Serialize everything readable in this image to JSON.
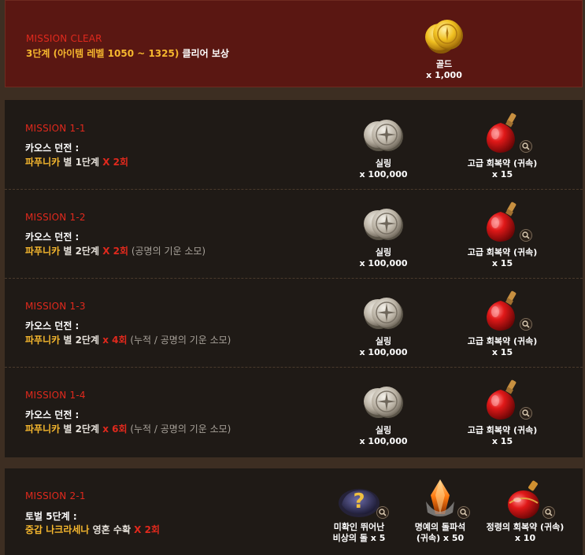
{
  "clear": {
    "title": "MISSION CLEAR",
    "desc_yellow": "3단계 (아이템 레벨 1050 ~ 1325)",
    "desc_white": " 클리어 보상",
    "reward": {
      "name": "골드",
      "qty": "x 1,000",
      "icon": "gold-coins-icon"
    }
  },
  "missions": [
    {
      "title": "MISSION 1-1",
      "line1": "카오스 던전 :",
      "target": "파푸니카",
      "mid": " 별 1단계 ",
      "count": "X 2회",
      "note": "",
      "rewards": [
        {
          "name": "실링",
          "qty": "x 100,000",
          "icon": "silling-coins-icon"
        },
        {
          "name": "고급 회복약 (귀속)",
          "qty": "x 15",
          "icon": "red-potion-icon"
        }
      ]
    },
    {
      "title": "MISSION 1-2",
      "line1": "카오스 던전 :",
      "target": "파푸니카",
      "mid": " 별 2단계 ",
      "count": "X 2회",
      "note": " (공명의 기운 소모)",
      "rewards": [
        {
          "name": "실링",
          "qty": "x 100,000",
          "icon": "silling-coins-icon"
        },
        {
          "name": "고급 회복약 (귀속)",
          "qty": "x 15",
          "icon": "red-potion-icon"
        }
      ]
    },
    {
      "title": "MISSION 1-3",
      "line1": "카오스 던전 :",
      "target": "파푸니카",
      "mid": " 별 2단계 ",
      "count": "x 4회",
      "note": " (누적 / 공명의 기운 소모)",
      "rewards": [
        {
          "name": "실링",
          "qty": "x 100,000",
          "icon": "silling-coins-icon"
        },
        {
          "name": "고급 회복약 (귀속)",
          "qty": "x 15",
          "icon": "red-potion-icon"
        }
      ]
    },
    {
      "title": "MISSION 1-4",
      "line1": "카오스 던전 :",
      "target": "파푸니카",
      "mid": " 별 2단계 ",
      "count": "x 6회",
      "note": " (누적 / 공명의 기운 소모)",
      "rewards": [
        {
          "name": "실링",
          "qty": "x 100,000",
          "icon": "silling-coins-icon"
        },
        {
          "name": "고급 회복약 (귀속)",
          "qty": "x 15",
          "icon": "red-potion-icon"
        }
      ]
    }
  ],
  "mission2": {
    "title": "MISSION 2-1",
    "line1": "토벌 5단계 :",
    "target": "중갑 나크라세나",
    "mid": " 영혼 수확 ",
    "count": "X 2회",
    "rewards": [
      {
        "name": "미확인 뛰어난",
        "name2": "비상의 돌 x 5",
        "icon": "mystery-stone-icon"
      },
      {
        "name": "명예의 돌파석",
        "name2": "(귀속) x 50",
        "icon": "breakthrough-stone-icon"
      },
      {
        "name": "정령의 회복약 (귀속)",
        "name2": "x 10",
        "icon": "spirit-potion-icon"
      }
    ]
  },
  "colors": {
    "mission_red": "#e0291d",
    "highlight_yellow": "#f5b72e"
  }
}
